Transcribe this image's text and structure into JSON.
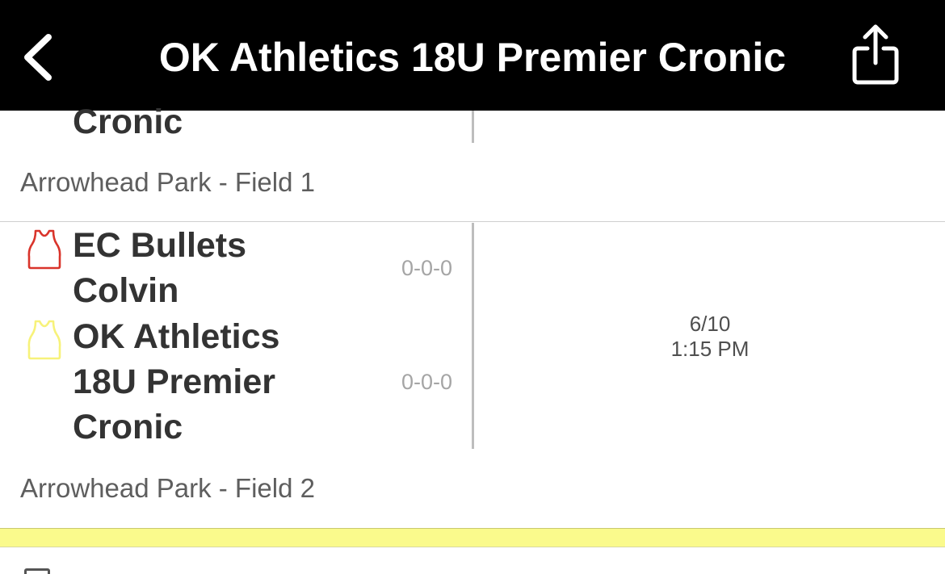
{
  "header": {
    "title": "OK Athletics 18U Premier Cronic",
    "back_icon": "chevron-left-icon",
    "share_icon": "share-icon"
  },
  "game_previous": {
    "team_partial_name": "Cronic",
    "location": "Arrowhead Park - Field 1"
  },
  "game_current": {
    "teams": [
      {
        "name_lines": [
          "EC Bullets",
          "Colvin"
        ],
        "record": "0-0-0",
        "jersey_icon": "jersey-icon",
        "jersey_color": "#d9342b"
      },
      {
        "name_lines": [
          "OK Athletics",
          "18U Premier",
          "Cronic"
        ],
        "record": "0-0-0",
        "jersey_icon": "jersey-icon",
        "jersey_color": "#f7f27a"
      }
    ],
    "date": "6/10",
    "time": "1:15 PM",
    "location": "Arrowhead Park - Field 2"
  },
  "colors": {
    "header_bg": "#000000",
    "highlight": "#fafa8c"
  }
}
